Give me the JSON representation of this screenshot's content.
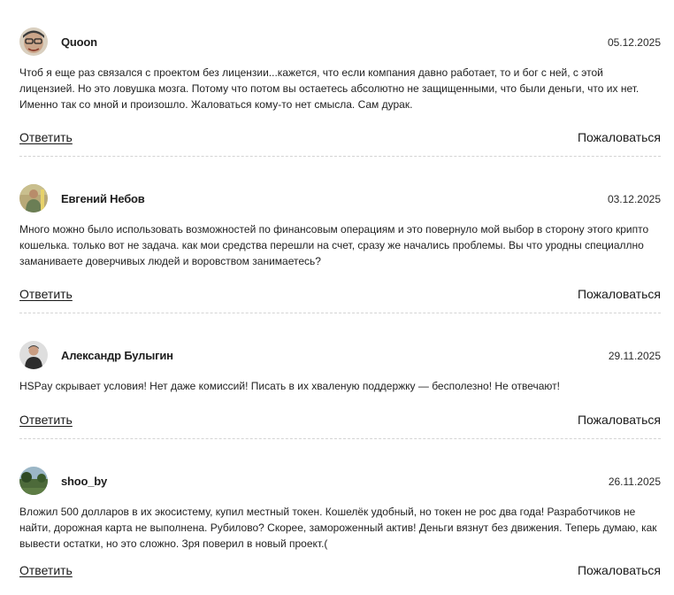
{
  "reviews": [
    {
      "author": "Quoon",
      "date": "05.12.2025",
      "avatar_icon": "cartoon-face-avatar-icon",
      "text": "Чтоб я еще раз связался с проектом без лицензии...кажется, что если компания давно работает, то и бог с ней, с этой лицензией. Но это ловушка мозга. Потому что потом вы остаетесь абсолютно не защищенными, что были деньги, что их нет. Именно так со мной и произошло. Жаловаться кому-то нет смысла. Сам дурак.",
      "reply_label": "Ответить",
      "complain_label": "Пожаловаться"
    },
    {
      "author": "Евгений Небов",
      "date": "03.12.2025",
      "avatar_icon": "person-outdoor-avatar-icon",
      "text": "Много можно было использовать возможностей по финансовым операциям и это повернуло мой выбор в сторону этого крипто кошелька. только вот не задача. как мои средства перешли на счет, сразу же начались проблемы. Вы что уродны специаллно заманиваете доверчивых людей и воровством занимаетесь?",
      "reply_label": "Ответить",
      "complain_label": "Пожаловаться"
    },
    {
      "author": "Александр Булыгин",
      "date": "29.11.2025",
      "avatar_icon": "person-portrait-avatar-icon",
      "text": "HSPay скрывает условия! Нет даже комиссий! Писать в их хваленую поддержку — бесполезно! Не отвечают!",
      "reply_label": "Ответить",
      "complain_label": "Пожаловаться"
    },
    {
      "author": "shoo_by",
      "date": "26.11.2025",
      "avatar_icon": "landscape-avatar-icon",
      "text": "Вложил 500 долларов в их экосистему, купил местный токен. Кошелёк удобный, но токен не рос два года! Разработчиков не найти, дорожная карта не выполнена. Рубилово? Скорее, замороженный актив! Деньги вязнут без движения. Теперь думаю, как вывести остатки, но это сложно. Зря поверил в новый проект.(",
      "reply_label": "Ответить",
      "complain_label": "Пожаловаться"
    }
  ]
}
